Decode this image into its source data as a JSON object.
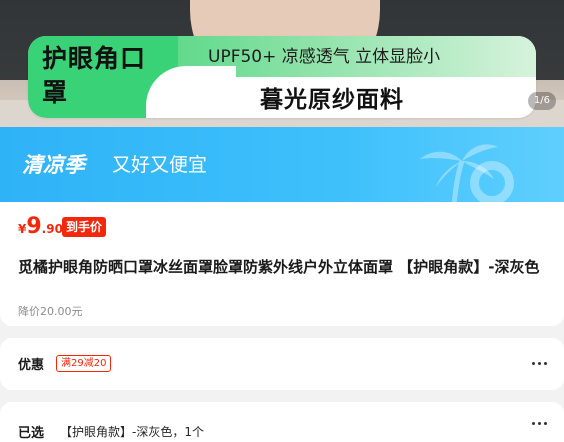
{
  "hero": {
    "banner_title": "护眼角口罩",
    "banner_features": "UPF50+ 凉感透气 立体显脸小",
    "banner_fabric": "暮光原纱面料",
    "image_counter": "1/6"
  },
  "promo": {
    "season": "清凉季",
    "slogan": "又好又便宜"
  },
  "price": {
    "currency": "¥",
    "integer": "9",
    "decimal": ".90",
    "badge": "到手价",
    "original": "降价20.00元"
  },
  "product": {
    "title": "觅橘护眼角防晒口罩冰丝面罩脸罩防紫外线户外立体面罩 【护眼角款】-深灰色"
  },
  "offers": {
    "label": "优惠",
    "coupon": "满29减20"
  },
  "selected": {
    "label": "已选",
    "value": "【护眼角款】-深灰色，1个"
  },
  "colors": {
    "price_red": "#f2270c",
    "promo_blue": "#2fb3f7",
    "banner_green": "#39d277"
  }
}
